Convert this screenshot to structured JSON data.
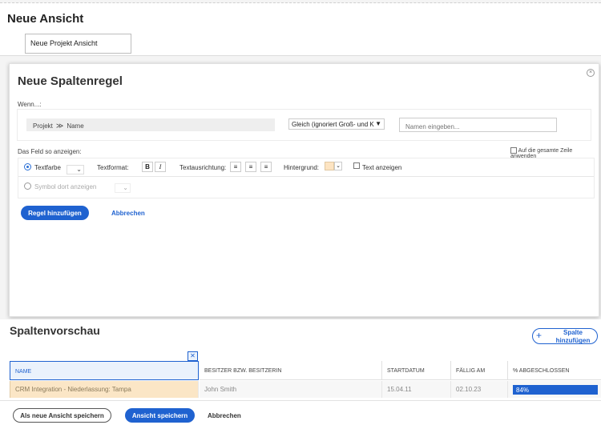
{
  "page": {
    "title": "Neue Ansicht",
    "view_name": "Neue Projekt Ansicht"
  },
  "rule": {
    "title": "Neue Spaltenregel",
    "close": "×",
    "when_label": "Wenn...:",
    "condition": {
      "field_object": "Projekt",
      "field_separator": "≫",
      "field_name": "Name",
      "operator": "Gleich (ignoriert Groß- und K",
      "value_placeholder": "Namen eingeben..."
    },
    "display_label": "Das Feld so anzeigen:",
    "entire_row_label": "Auf die gesamte Zeile anwenden",
    "options": {
      "text_color_label": "Textfarbe",
      "text_format_label": "Textformat:",
      "bold": "B",
      "italic": "I",
      "align_label": "Textausrichtung:",
      "background_label": "Hintergrund:",
      "background_color": "#fde4c2",
      "show_text_label": "Text anzeigen",
      "symbol_label": "Symbol dort anzeigen"
    },
    "add_rule_button": "Regel hinzufügen",
    "cancel_link": "Abbrechen"
  },
  "preview": {
    "title": "Spaltenvorschau",
    "add_column_button": "Spalte hinzufügen",
    "columns": [
      "NAME",
      "BESITZER BZW. BESITZERIN",
      "STARTDATUM",
      "FÄLLIG AM",
      "% ABGESCHLOSSEN"
    ],
    "row": {
      "name": "CRM Integration - Niederlassung: Tampa",
      "owner": "John Smith",
      "start": "15.04.11",
      "due": "02.10.23",
      "percent": "84%"
    }
  },
  "footer": {
    "save_as_new": "Als neue Ansicht speichern",
    "save": "Ansicht speichern",
    "cancel": "Abbrechen"
  },
  "colors": {
    "accent": "#1f62d0",
    "highlight": "#fbe6c6"
  }
}
